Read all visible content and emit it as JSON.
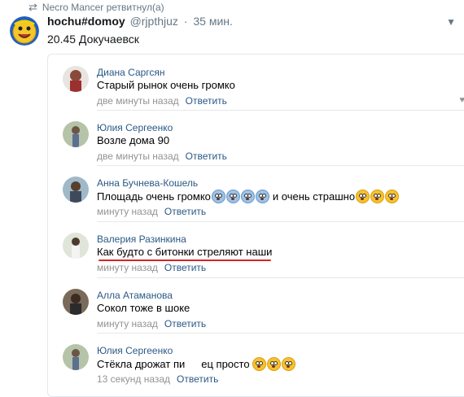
{
  "retweet": {
    "label": "Necro Mancer ретвитнул(а)"
  },
  "tweet": {
    "name": "hochu#domoy",
    "handle": "@rjpthjuz",
    "sep": "·",
    "time": "35 мин.",
    "text": "20.45 Докучаевск"
  },
  "comments": [
    {
      "name": "Диана Саргсян",
      "text": "Старый рынок очень громко",
      "time": "две минуты назад",
      "reply": "Ответить"
    },
    {
      "name": "Юлия Сергеенко",
      "text": "Возле дома 90",
      "time": "две минуты назад",
      "reply": "Ответить"
    },
    {
      "name": "Анна Бучнева-Кошель",
      "text": "Площадь очень громко",
      "text2": "и очень страшно",
      "time": "минуту назад",
      "reply": "Ответить"
    },
    {
      "name": "Валерия Разинкина",
      "text": "Как будто с битонки стреляют наши",
      "time": "минуту назад",
      "reply": "Ответить"
    },
    {
      "name": "Алла Атаманова",
      "text": "Сокол тоже в шоке",
      "time": "минуту назад",
      "reply": "Ответить"
    },
    {
      "name": "Юлия Сергеенко",
      "text": "Стёкла дрожат пи",
      "text2": "ец просто",
      "time": "13 секунд назад",
      "reply": "Ответить"
    }
  ],
  "icons": {
    "retweet": "retweet-icon",
    "caret": "chevron-down-icon",
    "like": "heart-icon"
  },
  "colors": {
    "link": "#2a5885",
    "meta": "#939393",
    "accent_underline": "#dd2222"
  }
}
